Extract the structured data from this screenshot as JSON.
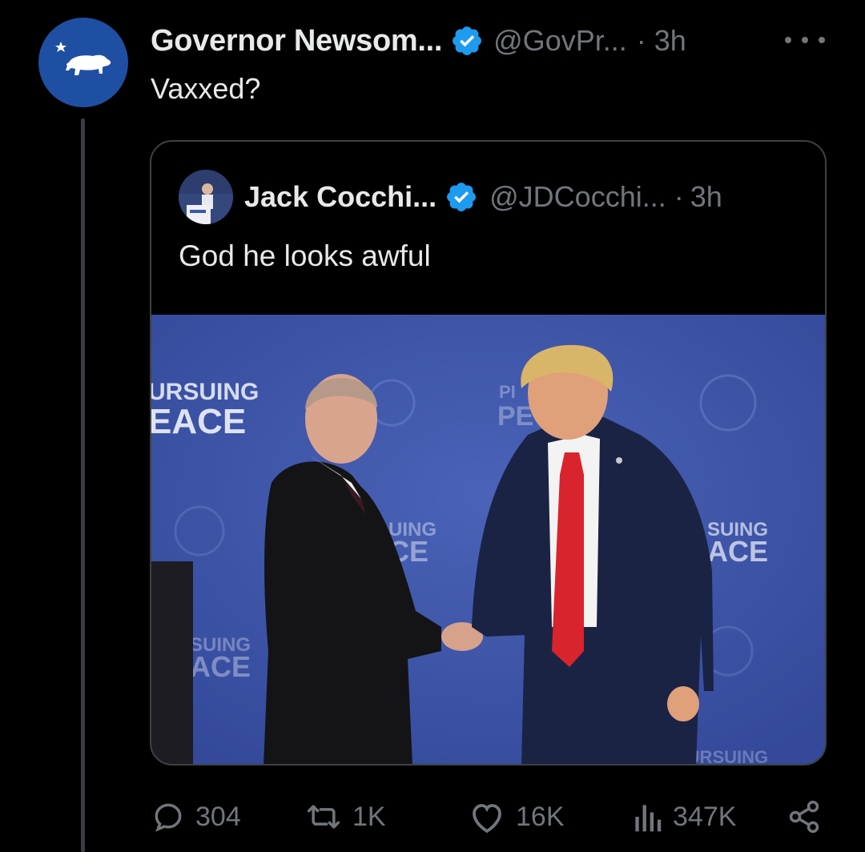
{
  "post": {
    "author": {
      "display_name": "Governor Newsom...",
      "handle": "@GovPr...",
      "verified": true,
      "avatar_icon": "california-bear-icon",
      "avatar_color": "#1f4fa3"
    },
    "separator": "·",
    "time": "3h",
    "text": "Vaxxed?"
  },
  "quoted_post": {
    "author": {
      "display_name": "Jack Cocchi...",
      "handle": "@JDCocchi...",
      "verified": true
    },
    "separator": "·",
    "time": "3h",
    "text": "God he looks awful",
    "media": {
      "backdrop_texts": [
        "URSUING",
        "EACE",
        "PI",
        "PE",
        "UING",
        "CE",
        "SUING",
        "ACE",
        "SUING",
        "ACE",
        "PURSUING"
      ]
    }
  },
  "actions": {
    "replies": "304",
    "reposts": "1K",
    "likes": "16K",
    "views": "347K"
  },
  "colors": {
    "background": "#000000",
    "primary_text": "#e7e9ea",
    "secondary_text": "#71767b",
    "verified_blue": "#1d9bf0",
    "border": "#3e4144"
  }
}
